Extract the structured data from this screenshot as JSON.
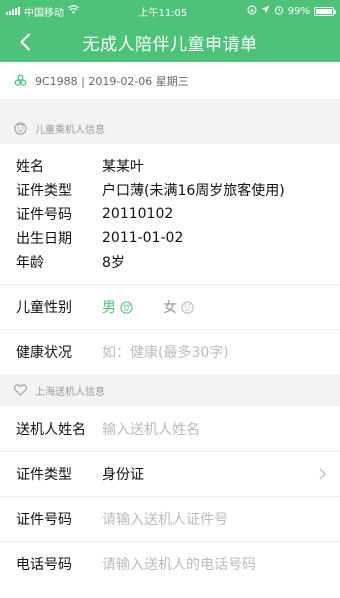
{
  "status_bar": {
    "carrier": "中国移动",
    "time": "上午11:05",
    "battery": "99%",
    "battery_level": 0.99
  },
  "nav": {
    "title": "无成人陪伴儿童申请单"
  },
  "flight": {
    "text": "9C1988 | 2019-02-06 星期三"
  },
  "child_section": {
    "title": "儿童乘机人信息",
    "rows": [
      {
        "label": "姓名",
        "value": "某某叶"
      },
      {
        "label": "证件类型",
        "value": "户口薄(未满16周岁旅客使用)"
      },
      {
        "label": "证件号码",
        "value": "20110102"
      },
      {
        "label": "出生日期",
        "value": "2011-01-02"
      },
      {
        "label": "年龄",
        "value": "8岁"
      }
    ],
    "gender": {
      "label": "儿童性别",
      "male": "男",
      "female": "女",
      "selected": "男"
    },
    "health": {
      "label": "健康状况",
      "placeholder": "如：健康(最多30字)"
    }
  },
  "sender_section": {
    "title": "上海送机人信息",
    "name": {
      "label": "送机人姓名",
      "placeholder": "输入送机人姓名"
    },
    "id_type": {
      "label": "证件类型",
      "value": "身份证"
    },
    "id_number": {
      "label": "证件号码",
      "placeholder": "请输入送机人证件号"
    },
    "phone": {
      "label": "电话号码",
      "placeholder": "请输入送机人的电话号码"
    }
  },
  "colors": {
    "brand": "#4fc27a",
    "placeholder": "#bbbbbb",
    "section_bg": "#f3f3f3"
  }
}
